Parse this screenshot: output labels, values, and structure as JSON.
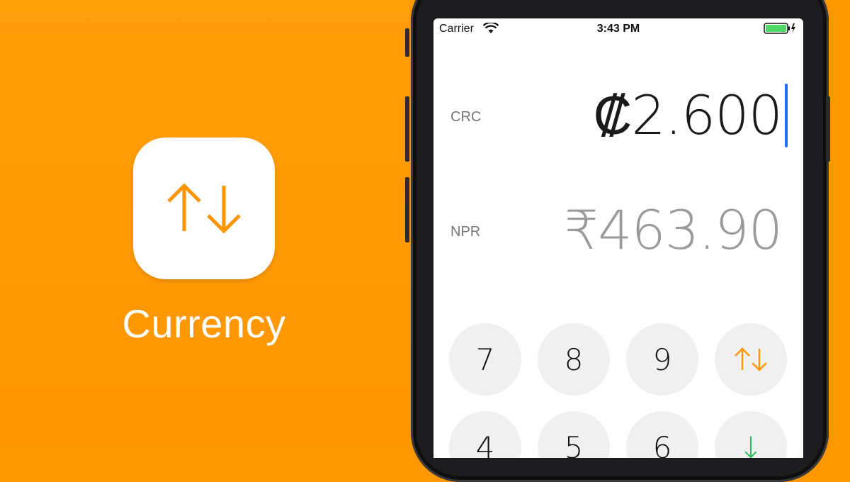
{
  "app": {
    "name": "Currency",
    "icon": "swap-arrows-icon",
    "accent": "#ff9500"
  },
  "status_bar": {
    "carrier": "Carrier",
    "time": "3:43 PM",
    "battery": "full-charging"
  },
  "converter": {
    "from": {
      "code": "CRC",
      "amount": "₡2.600"
    },
    "to": {
      "code": "NPR",
      "amount": "₹463.90"
    }
  },
  "keypad": {
    "row1": [
      "7",
      "8",
      "9",
      "⇅"
    ],
    "row2": [
      "4",
      "5",
      "6",
      "↓"
    ]
  }
}
